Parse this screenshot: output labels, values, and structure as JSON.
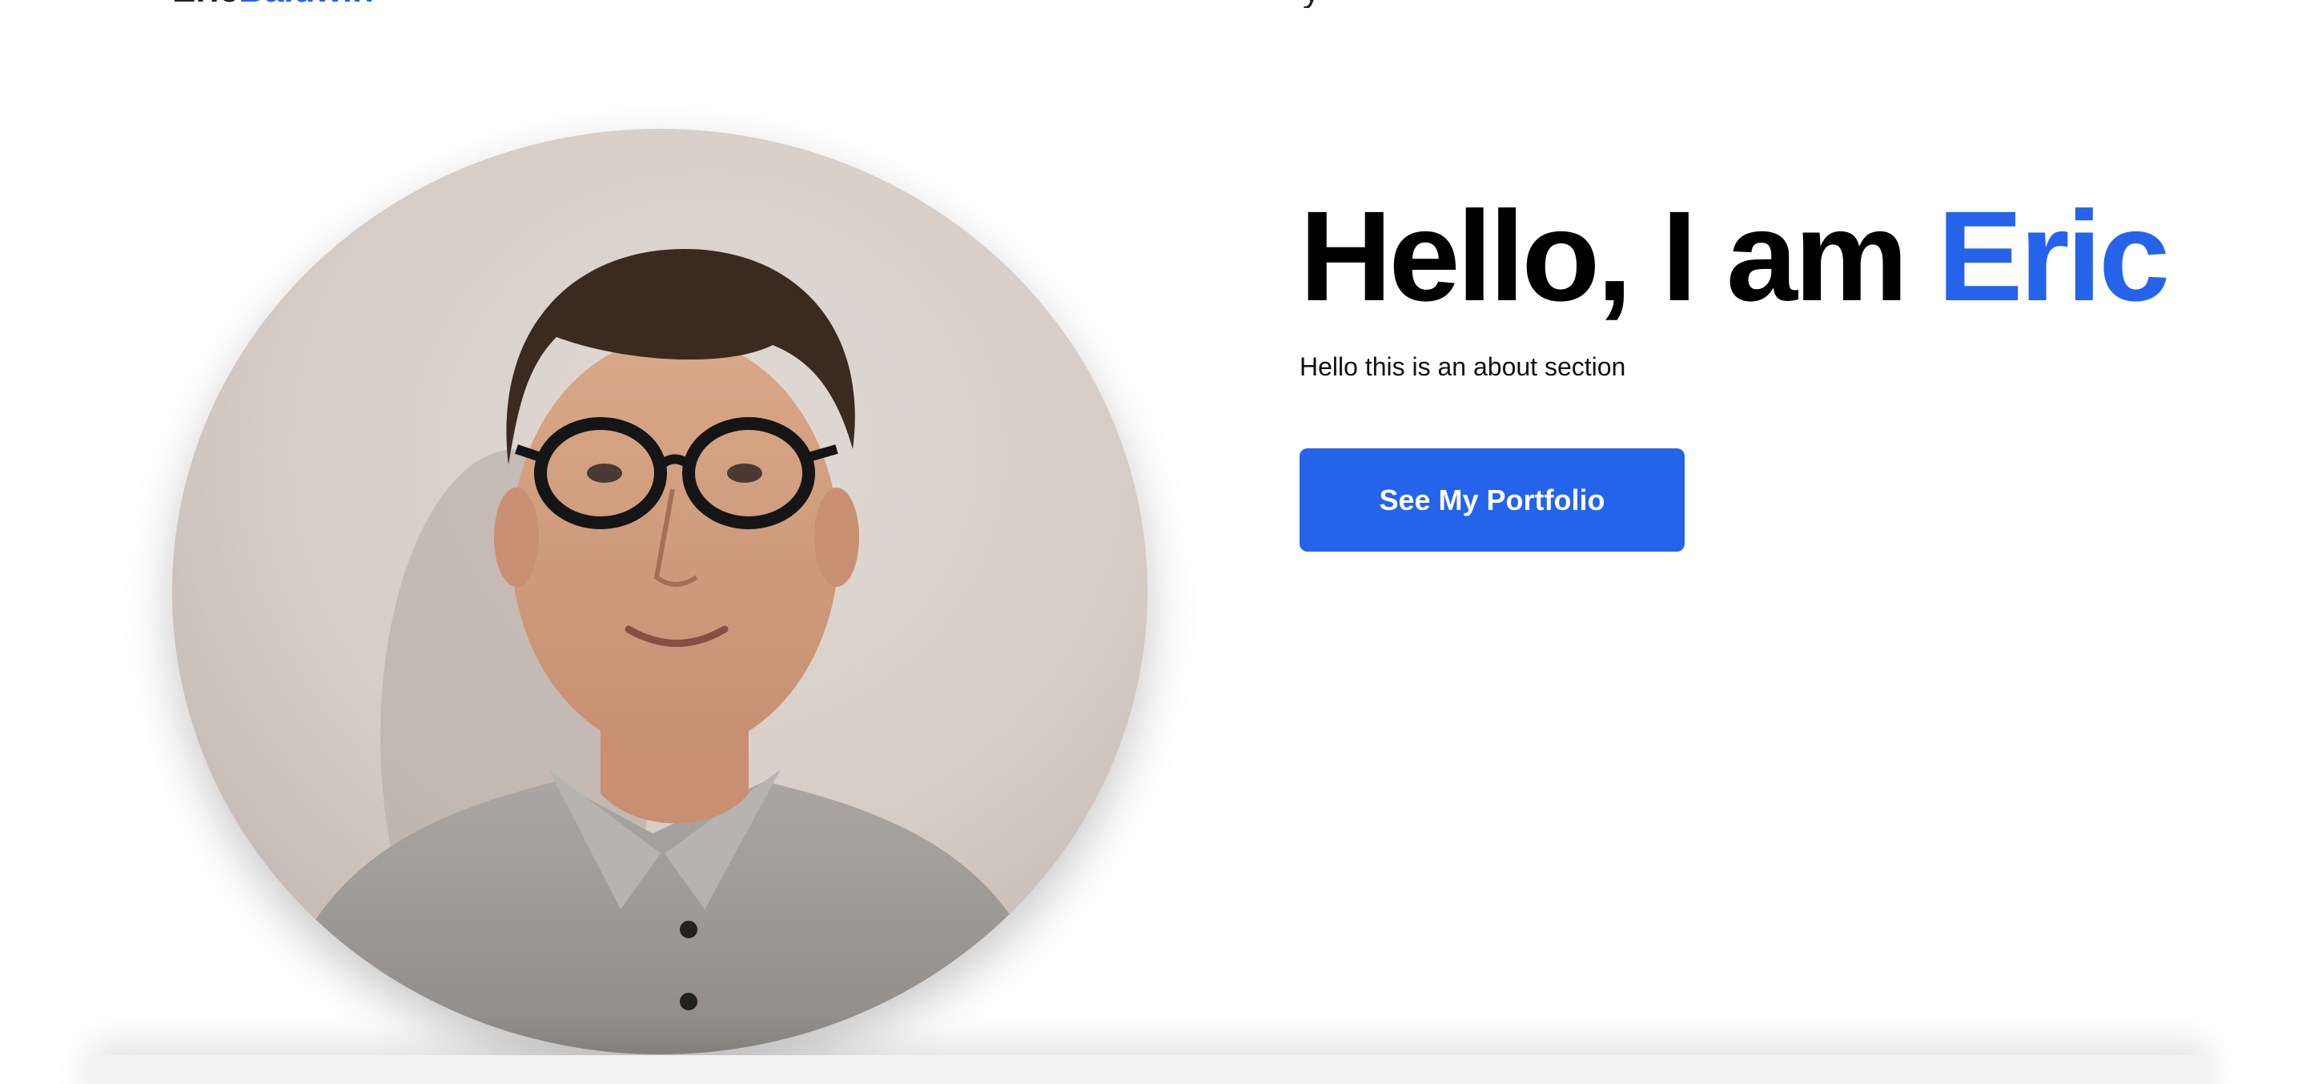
{
  "navbar": {
    "brand_first": "Eric",
    "brand_last": "Baldwin",
    "nav_fragment": "y"
  },
  "hero": {
    "title_prefix": "Hello, I am ",
    "title_name": "Eric",
    "subtitle": "Hello this is an about section",
    "cta_label": "See My Portfolio"
  },
  "colors": {
    "accent": "#2563eb",
    "text": "#000000",
    "background": "#ffffff"
  }
}
